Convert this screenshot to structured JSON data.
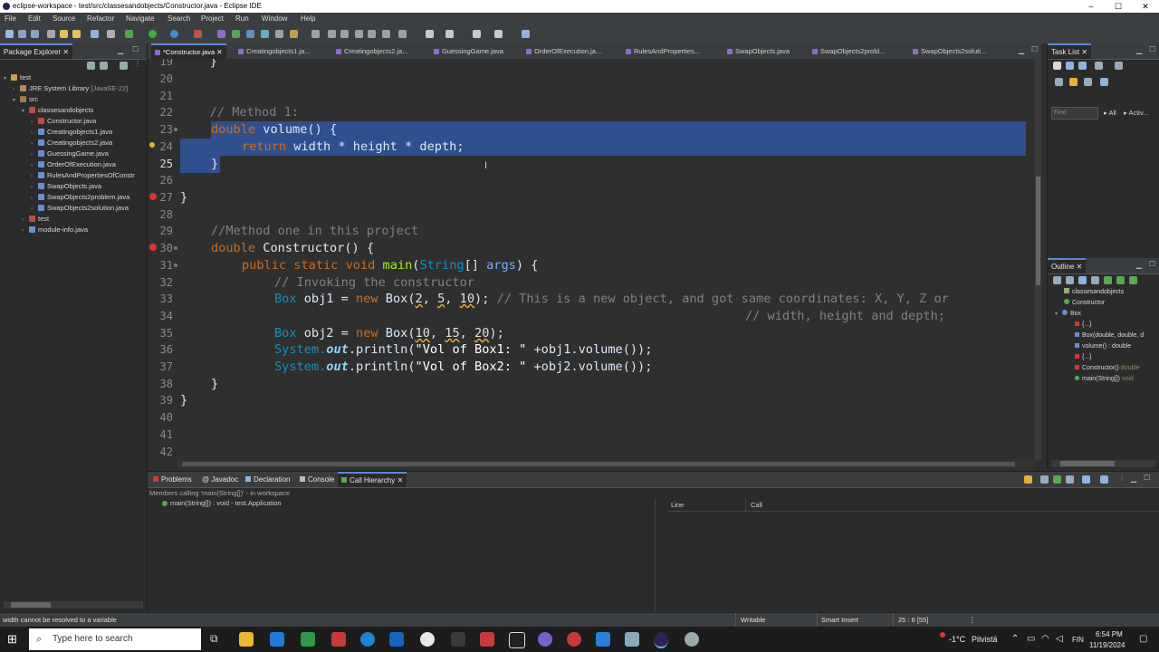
{
  "window": {
    "title": "eclipse-workspace - test/src/classesandobjects/Constructor.java - Eclipse IDE",
    "minimize": "‒",
    "maximize": "☐",
    "close": "✕"
  },
  "menu": [
    "File",
    "Edit",
    "Source",
    "Refactor",
    "Navigate",
    "Search",
    "Project",
    "Run",
    "Window",
    "Help"
  ],
  "package_explorer": {
    "tab_label": "Package Explorer",
    "items": [
      {
        "label": "test",
        "type": "project"
      },
      {
        "label": "JRE System Library",
        "suffix": "[JavaSE-22]",
        "type": "library"
      },
      {
        "label": "src",
        "type": "folder"
      },
      {
        "label": "classesandobjects",
        "type": "package"
      },
      {
        "label": "Constructor.java",
        "type": "file"
      },
      {
        "label": "Creatingobjects1.java",
        "type": "file"
      },
      {
        "label": "Creatingobjects2.java",
        "type": "file"
      },
      {
        "label": "GuessingGame.java",
        "type": "file"
      },
      {
        "label": "OrderOfExecution.java",
        "type": "file"
      },
      {
        "label": "RulesAndPropertiesOfConstr",
        "type": "file"
      },
      {
        "label": "SwapObjects.java",
        "type": "file"
      },
      {
        "label": "SwapObjects2problem.java",
        "type": "file"
      },
      {
        "label": "SwapObjects2solution.java",
        "type": "file"
      },
      {
        "label": "test",
        "type": "package"
      },
      {
        "label": "module-info.java",
        "type": "file"
      }
    ]
  },
  "editor": {
    "tabs": [
      "*Constructor.java",
      "Creatingobjects1.ja...",
      "Creatingobjects2.ja...",
      "GuessingGame.java",
      "OrderOfExecution.ja...",
      "RulesAndProperties...",
      "SwapObjects.java",
      "SwapObjects2probl...",
      "SwapObjects2soluti..."
    ],
    "line_numbers": [
      "19",
      "20",
      "21",
      "22",
      "23",
      "24",
      "25",
      "26",
      "27",
      "28",
      "29",
      "30",
      "31",
      "32",
      "33",
      "34",
      "35",
      "36",
      "37",
      "38",
      "39",
      "40",
      "41",
      "42"
    ],
    "code": {
      "l19": "    }",
      "l22": "    // Method 1:",
      "l23_kw": "double",
      "l23_rest": " volume() {",
      "l24_kw": "return",
      "l24_rest": " width * height * depth;",
      "l25": "}",
      "l27": "}",
      "l29": "//Method one in this project",
      "l30_kw": "double",
      "l30_rest": " Constructor() {",
      "l31_kw": "public static void",
      "l31_fn": "main",
      "l31_ty": "String",
      "l31_rest": "[] ",
      "l31_var": "args",
      "l31_end": ") {",
      "l32": "// Invoking the constructor",
      "l33_ty": "Box",
      "l33_var": " obj1 = ",
      "l33_kw": "new",
      "l33_fn": " Box(",
      "l33_a": "2",
      "l33_b": "5",
      "l33_c": "10",
      "l33_end": ");",
      "l33_cm": " // This is a new object, and got same coordinates: X, Y, Z or",
      "l34_cm": "// width, height and depth;",
      "l35_ty": "Box",
      "l35_var": " obj2 = ",
      "l35_kw": "new",
      "l35_fn": " Box(",
      "l35_a": "10",
      "l35_b": "15",
      "l35_c": "20",
      "l35_end": ");",
      "l36_sys": "System.",
      "l36_out": "out",
      "l36_fn": ".println(",
      "l36_str": "\"Vol of Box1: \"",
      "l36_rest": " +obj1.volume());",
      "l37_sys": "System.",
      "l37_out": "out",
      "l37_fn": ".println(",
      "l37_str": "\"Vol of Box2: \"",
      "l37_rest": " +obj2.volume());",
      "l38": "}",
      "l39": "}"
    }
  },
  "task_list": {
    "tab_label": "Task List",
    "find_placeholder": "Find",
    "all": "All",
    "activate": "Activ..."
  },
  "outline": {
    "tab_label": "Outline",
    "items": [
      "classesandobjects",
      "Constructor",
      "Box",
      "{...}",
      "Box(double, double, d",
      "volume() : double",
      "{...}",
      "Constructor()",
      "main(String[])"
    ],
    "suffixes": {
      "constructor": "double",
      "main": "void"
    }
  },
  "bottom": {
    "tabs": [
      "Problems",
      "Javadoc",
      "Declaration",
      "Console",
      "Call Hierarchy"
    ],
    "description": "Members calling 'main(String[])' - in workspace",
    "row": "main(String[]) : void - test.Application",
    "col_line": "Line",
    "col_call": "Call"
  },
  "status": {
    "message": "width cannot be resolved to a variable",
    "writable": "Writable",
    "insert": "Smart Insert",
    "position": "25 : 6 [55]"
  },
  "taskbar": {
    "search": "Type here to search",
    "weather": "-1°C",
    "weather_desc": "Pilvistä",
    "lang": "FIN",
    "time": "6:54 PM",
    "date": "11/19/2024"
  }
}
